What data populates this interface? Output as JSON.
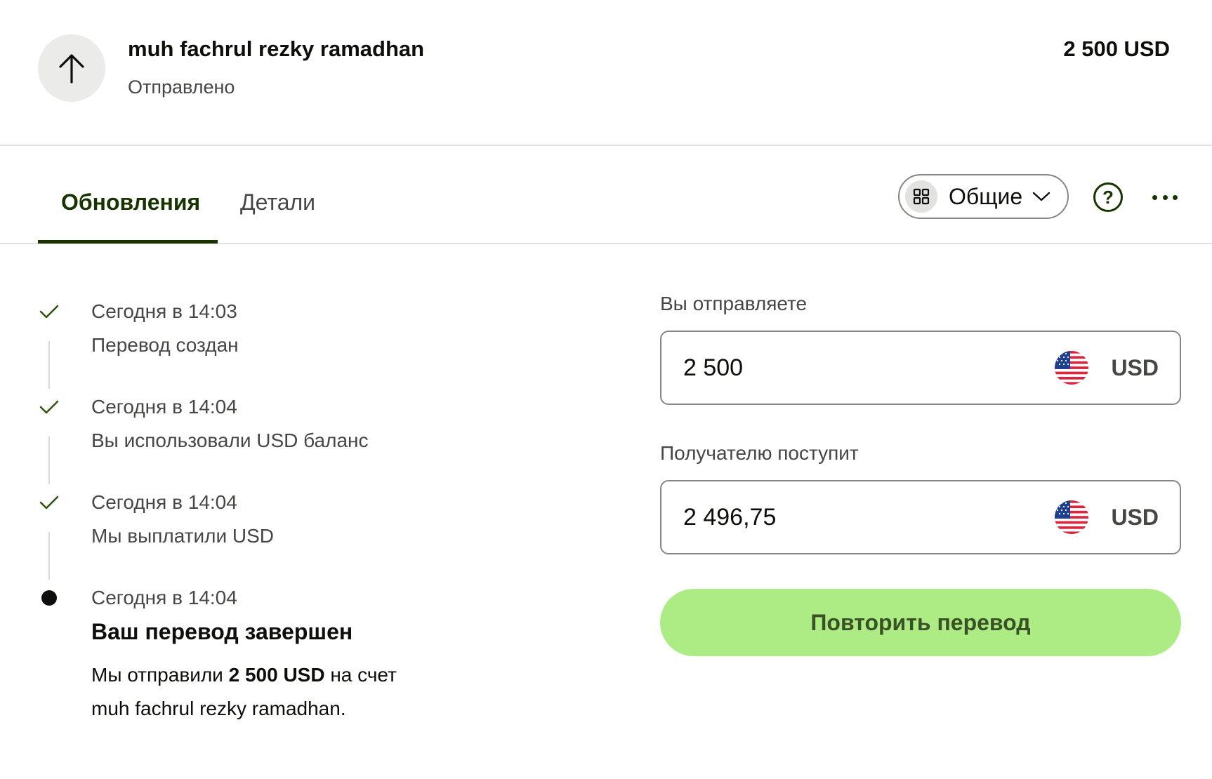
{
  "header": {
    "recipient_name": "muh fachrul rezky ramadhan",
    "status": "Отправлено",
    "amount": "2 500 USD",
    "icon": "arrow-up-icon"
  },
  "tabs": [
    {
      "label": "Обновления",
      "active": true
    },
    {
      "label": "Детали",
      "active": false
    }
  ],
  "toolbar": {
    "filter_label": "Общие",
    "filter_icon": "grid-icon",
    "help_icon": "question-circle-icon",
    "more_icon": "more-horizontal-icon"
  },
  "timeline": [
    {
      "time": "Сегодня в 14:03",
      "description": "Перевод создан",
      "state": "done"
    },
    {
      "time": "Сегодня в 14:04",
      "description": "Вы использовали USD баланс",
      "state": "done"
    },
    {
      "time": "Сегодня в 14:04",
      "description": "Мы выплатили USD",
      "state": "done"
    },
    {
      "time": "Сегодня в 14:04",
      "title": "Ваш перевод завершен",
      "body_prefix": "Мы отправили ",
      "body_amount": "2 500 USD",
      "body_suffix": " на счет",
      "body_recipient": "muh fachrul rezky ramadhan.",
      "state": "current"
    }
  ],
  "send": {
    "label": "Вы отправляете",
    "value": "2 500",
    "currency": "USD",
    "flag_icon": "us-flag-icon"
  },
  "receive": {
    "label": "Получателю поступит",
    "value": "2 496,75",
    "currency": "USD",
    "flag_icon": "us-flag-icon"
  },
  "actions": {
    "repeat_label": "Повторить перевод"
  },
  "colors": {
    "brand_dark": "#163300",
    "brand_green": "#9fe870",
    "check_green": "#2f5711",
    "text_primary": "#0e0f0c",
    "text_secondary": "#454745"
  }
}
